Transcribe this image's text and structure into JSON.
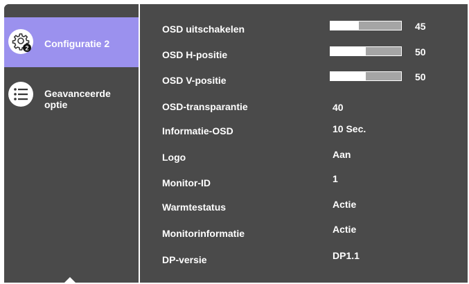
{
  "sidebar": {
    "items": [
      {
        "label": "Configuratie 2",
        "icon": "gear-icon",
        "badge": "2",
        "selected": true
      },
      {
        "label": "Geavanceerde optie",
        "icon": "list-icon",
        "selected": false
      }
    ]
  },
  "settings": [
    {
      "label": "OSD uitschakelen",
      "type": "slider",
      "value": "45",
      "level": 0.4
    },
    {
      "label": "OSD H-positie",
      "type": "slider",
      "value": "50",
      "level": 0.5
    },
    {
      "label": "OSD V-positie",
      "type": "slider",
      "value": "50",
      "level": 0.5
    },
    {
      "label": "OSD-transparantie",
      "type": "value",
      "value": "40"
    },
    {
      "label": "Informatie-OSD",
      "type": "value",
      "value": "10 Sec."
    },
    {
      "label": "Logo",
      "type": "value",
      "value": "Aan"
    },
    {
      "label": "Monitor-ID",
      "type": "value",
      "value": "1"
    },
    {
      "label": "Warmtestatus",
      "type": "value",
      "value": "Actie"
    },
    {
      "label": "Monitorinformatie",
      "type": "value",
      "value": "Actie"
    },
    {
      "label": "DP-versie",
      "type": "value",
      "value": "DP1.1"
    }
  ],
  "colors": {
    "background": "#4a4a4a",
    "selected": "#9b91ee",
    "slider_track": "#a5a5a5",
    "text": "#ffffff"
  }
}
